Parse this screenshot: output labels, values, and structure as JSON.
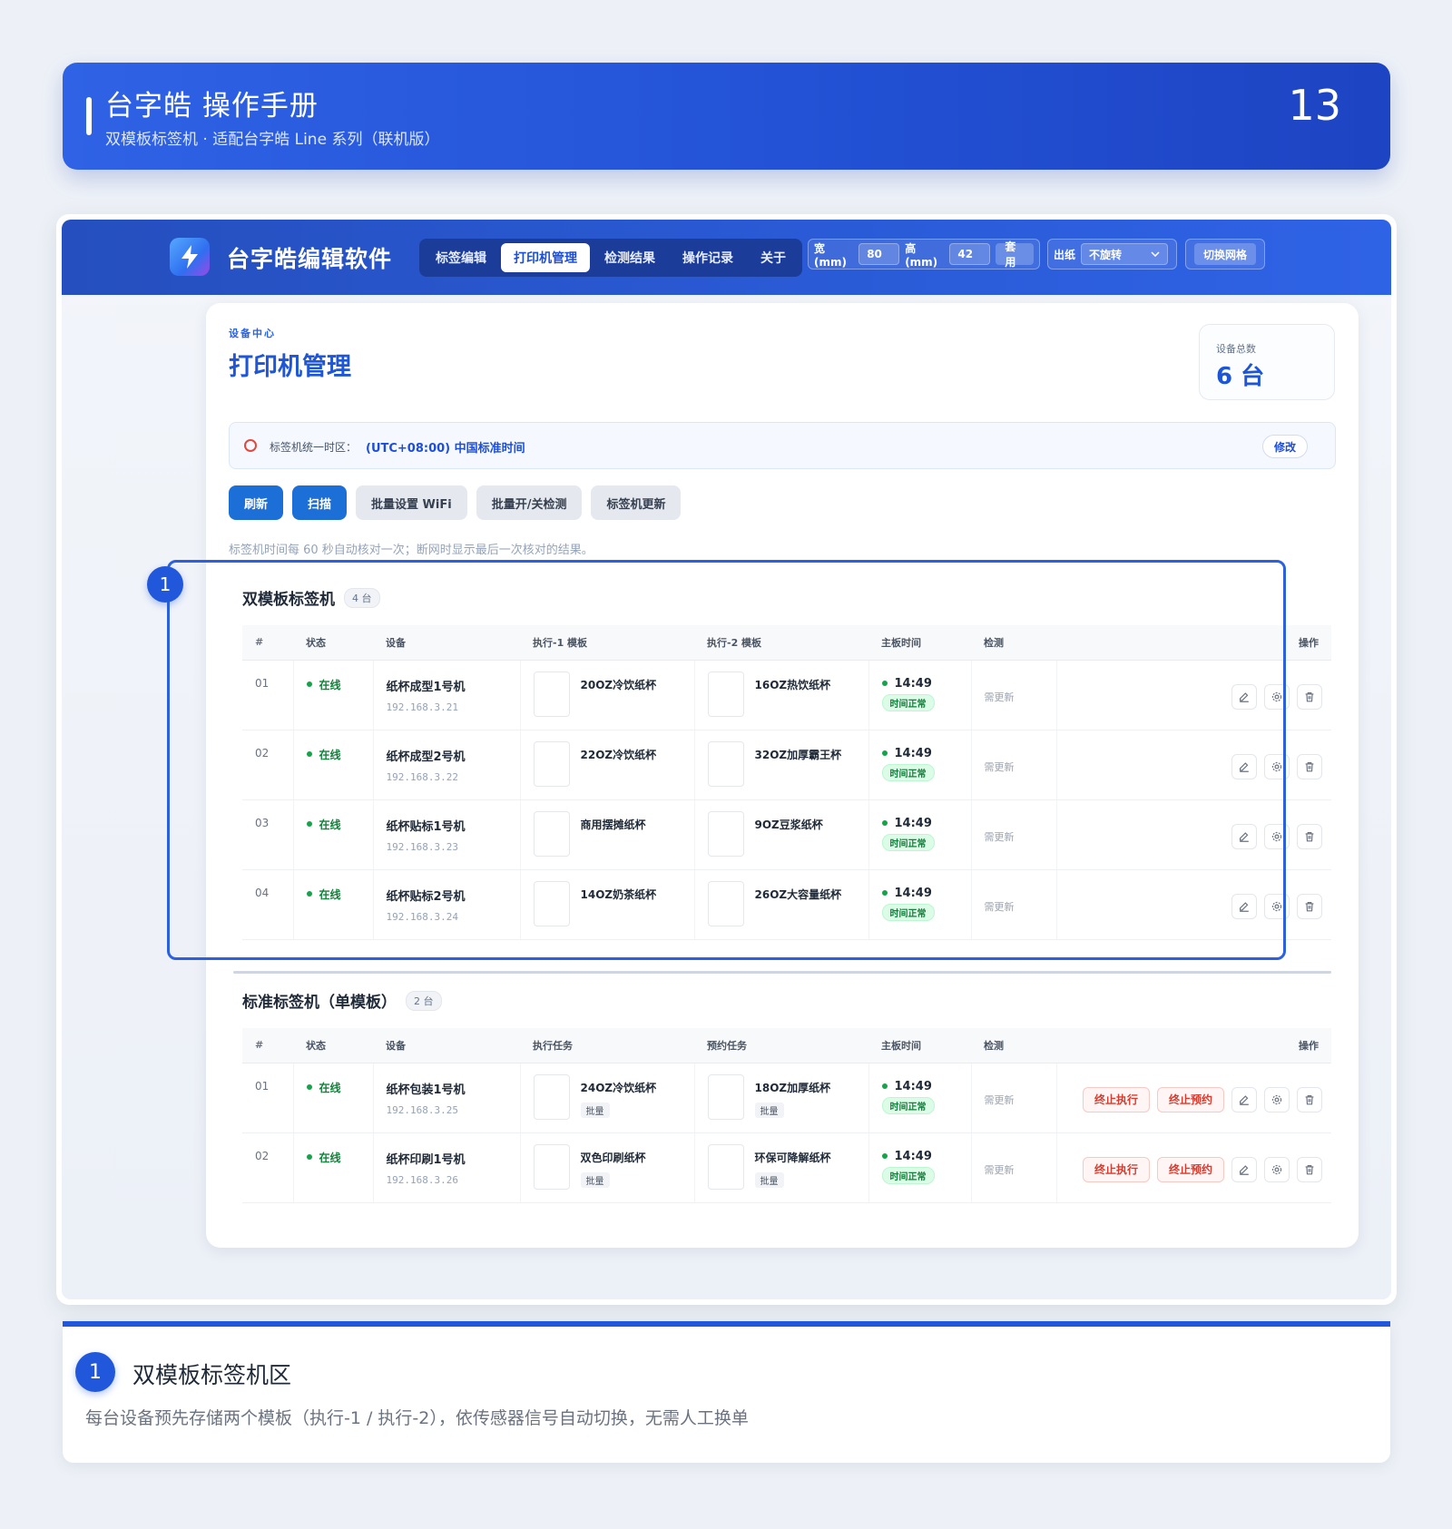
{
  "manual": {
    "title": "台字皓 操作手册",
    "subtitle": "双模板标签机 · 适配台字皓 Line 系列（联机版）",
    "page_number": "13"
  },
  "app": {
    "name": "台字皓编辑软件",
    "tabs": [
      {
        "label": "标签编辑",
        "active": false
      },
      {
        "label": "打印机管理",
        "active": true
      },
      {
        "label": "检测结果",
        "active": false
      },
      {
        "label": "操作记录",
        "active": false
      },
      {
        "label": "关于",
        "active": false
      }
    ],
    "size": {
      "width_label": "宽(mm)",
      "width_value": "80",
      "height_label": "高(mm)",
      "height_value": "42",
      "apply_label": "套用"
    },
    "output": {
      "label": "出纸",
      "selected": "不旋转"
    },
    "grid_button": "切换网格"
  },
  "page": {
    "eyebrow": "设备中心",
    "title": "打印机管理",
    "device_total_label": "设备总数",
    "device_total_value": "6 台",
    "timezone_label": "标签机统一时区：",
    "timezone_value": "(UTC+08:00) 中国标准时间",
    "timezone_edit": "修改",
    "buttons": [
      "刷新",
      "扫描",
      "批量设置 WiFi",
      "批量开/关检测",
      "标签机更新"
    ],
    "hint": "标签机时间每 60 秒自动核对一次；断网时显示最后一次核对的结果。"
  },
  "dual": {
    "title": "双模板标签机",
    "count": "4 台",
    "badge": "1",
    "headers": [
      "#",
      "状态",
      "设备",
      "执行-1 模板",
      "执行-2 模板",
      "主板时间",
      "检测",
      "操作"
    ],
    "rows": [
      {
        "idx": "01",
        "status": "在线",
        "name": "纸杯成型1号机",
        "ip": "192.168.3.21",
        "t1": "20OZ冷饮纸杯",
        "t2": "16OZ热饮纸杯",
        "time": "14:49",
        "time_status": "时间正常",
        "check": "需更新"
      },
      {
        "idx": "02",
        "status": "在线",
        "name": "纸杯成型2号机",
        "ip": "192.168.3.22",
        "t1": "22OZ冷饮纸杯",
        "t2": "32OZ加厚霸王杯",
        "time": "14:49",
        "time_status": "时间正常",
        "check": "需更新"
      },
      {
        "idx": "03",
        "status": "在线",
        "name": "纸杯贴标1号机",
        "ip": "192.168.3.23",
        "t1": "商用摆摊纸杯",
        "t2": "9OZ豆浆纸杯",
        "time": "14:49",
        "time_status": "时间正常",
        "check": "需更新"
      },
      {
        "idx": "04",
        "status": "在线",
        "name": "纸杯贴标2号机",
        "ip": "192.168.3.24",
        "t1": "14OZ奶茶纸杯",
        "t2": "26OZ大容量纸杯",
        "time": "14:49",
        "time_status": "时间正常",
        "check": "需更新"
      }
    ]
  },
  "single": {
    "title": "标准标签机（单模板）",
    "count": "2 台",
    "headers": [
      "#",
      "状态",
      "设备",
      "执行任务",
      "预约任务",
      "主板时间",
      "检测",
      "操作"
    ],
    "stop_exec": "终止执行",
    "stop_reserve": "终止预约",
    "rows": [
      {
        "idx": "01",
        "status": "在线",
        "name": "纸杯包装1号机",
        "ip": "192.168.3.25",
        "t1": "24OZ冷饮纸杯",
        "t1_tag": "批量",
        "t2": "18OZ加厚纸杯",
        "t2_tag": "批量",
        "time": "14:49",
        "time_status": "时间正常",
        "check": "需更新"
      },
      {
        "idx": "02",
        "status": "在线",
        "name": "纸杯印刷1号机",
        "ip": "192.168.3.26",
        "t1": "双色印刷纸杯",
        "t1_tag": "批量",
        "t2": "环保可降解纸杯",
        "t2_tag": "批量",
        "time": "14:49",
        "time_status": "时间正常",
        "check": "需更新"
      }
    ]
  },
  "note": {
    "badge": "1",
    "title": "双模板标签机区",
    "desc": "每台设备预先存储两个模板（执行-1 / 执行-2），依传感器信号自动切换，无需人工换单"
  },
  "colors": {
    "brand": "#2158db",
    "online": "#16803c",
    "danger": "#d63b2f"
  }
}
